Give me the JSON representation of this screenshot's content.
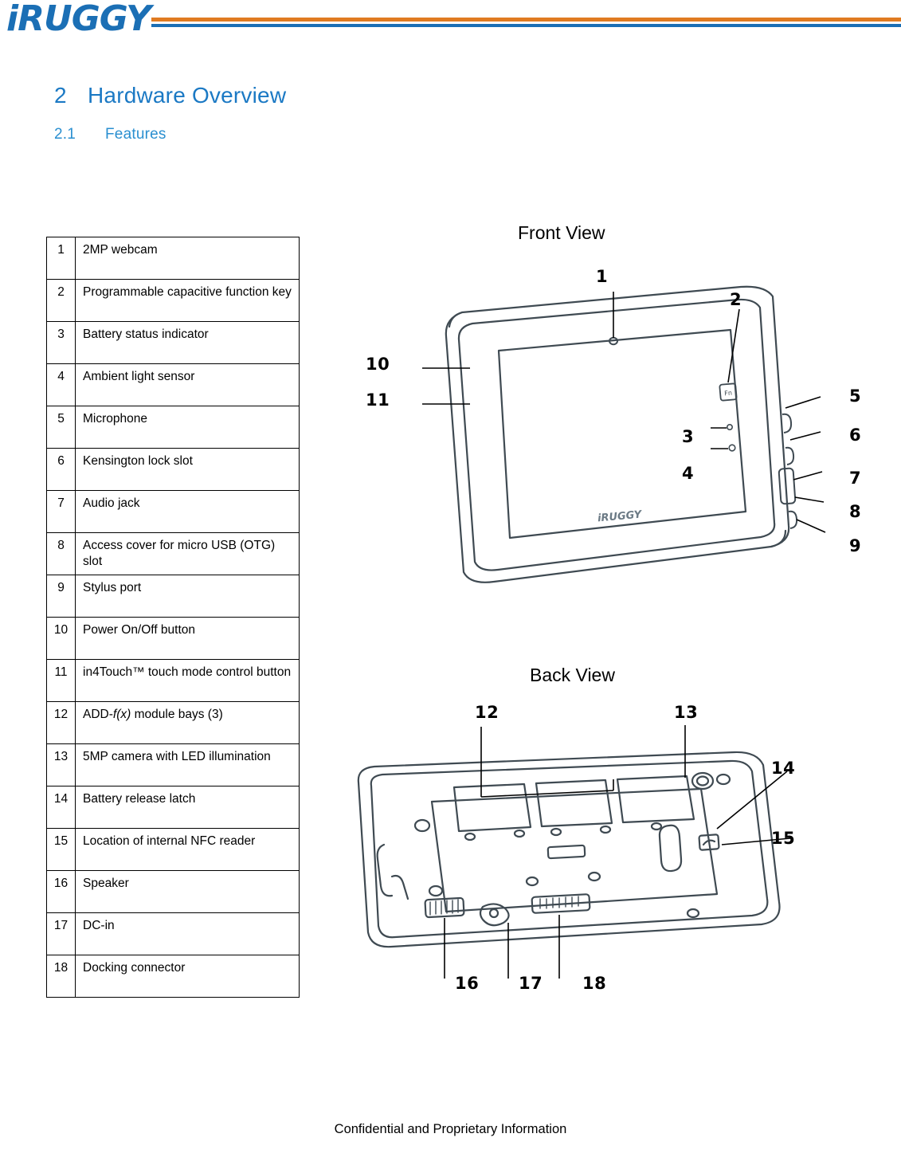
{
  "header": {
    "logo_text": "iRUGGY",
    "rule_colors": {
      "orange": "#e07b21",
      "blue": "#1b6fb5"
    }
  },
  "headings": {
    "section_number": "2",
    "section_title": "Hardware Overview",
    "subsection_number": "2.1",
    "subsection_title": "Features"
  },
  "features_table": {
    "rows": [
      {
        "index": "1",
        "label": "2MP webcam"
      },
      {
        "index": "2",
        "label": "Programmable capacitive function key"
      },
      {
        "index": "3",
        "label": "Battery status indicator"
      },
      {
        "index": "4",
        "label": "Ambient light sensor"
      },
      {
        "index": "5",
        "label": "Microphone"
      },
      {
        "index": "6",
        "label": "Kensington lock slot"
      },
      {
        "index": "7",
        "label": "Audio jack"
      },
      {
        "index": "8",
        "label": "Access cover for micro USB (OTG) slot"
      },
      {
        "index": "9",
        "label": "Stylus port"
      },
      {
        "index": "10",
        "label": "Power On/Off button"
      },
      {
        "index": "11",
        "label": "in4Touch™ touch mode control button"
      },
      {
        "index": "12",
        "label": "ADD-f(x) module bays (3)"
      },
      {
        "index": "13",
        "label": "5MP camera with LED illumination"
      },
      {
        "index": "14",
        "label": "Battery release latch"
      },
      {
        "index": "15",
        "label": "Location of internal NFC reader"
      },
      {
        "index": "16",
        "label": "Speaker"
      },
      {
        "index": "17",
        "label": "DC-in"
      },
      {
        "index": "18",
        "label": "Docking connector"
      }
    ]
  },
  "front_view": {
    "title": "Front View",
    "callouts": [
      "1",
      "2",
      "10",
      "11",
      "3",
      "4",
      "5",
      "6",
      "7",
      "8",
      "9"
    ],
    "device_logo": "iRUGGY",
    "fn_key_label": "Fn"
  },
  "back_view": {
    "title": "Back View",
    "callouts": [
      "12",
      "13",
      "14",
      "15",
      "16",
      "17",
      "18"
    ]
  },
  "footer": {
    "text": "Confidential and Proprietary Information"
  }
}
